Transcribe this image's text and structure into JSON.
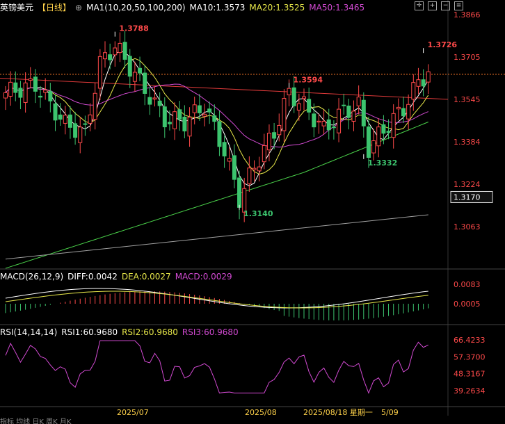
{
  "header": {
    "symbol": "英镑美元",
    "period": "【日线】",
    "ma_label": "MA1(10,20,50,100,200)",
    "ma10": "MA10:1.3573",
    "ma20": "MA20:1.3525",
    "ma50": "MA50:1.3465"
  },
  "macd_header": {
    "label": "MACD(26,12,9)",
    "diff": "DIFF:0.0042",
    "dea": "DEA:0.0027",
    "macd": "MACD:0.0029"
  },
  "rsi_header": {
    "label": "RSI(14,14,14)",
    "rsi1": "RSI1:60.9680",
    "rsi2": "RSI2:60.9680",
    "rsi3": "RSI3:60.9680"
  },
  "colors": {
    "up": "#ff4a4a",
    "down": "#3cc46e",
    "ma10": "#ffffff",
    "ma20": "#e8e84a",
    "ma50": "#d24ad2",
    "ma100": "#4ad24a",
    "ma200": "#a0a0a0",
    "trend": "#e03a3a",
    "rsi": "#d24ad2"
  },
  "chart_data": {
    "type": "candlestick",
    "y_axis_ticks": [
      "1.3866",
      "1.3705",
      "1.3545",
      "1.3384",
      "1.3224",
      "1.3063"
    ],
    "y_axis_values": [
      1.3866,
      1.3705,
      1.3545,
      1.3384,
      1.3224,
      1.3063
    ],
    "current_price": "1.3170",
    "x_labels": [
      "2025/07",
      "2025/08",
      "2025/08/18 星期一",
      "5/09"
    ],
    "annotations": [
      {
        "text": "1.3788",
        "value": 1.3788,
        "index": 22,
        "type": "high"
      },
      {
        "text": "1.3594",
        "value": 1.3594,
        "index": 57,
        "type": "high"
      },
      {
        "text": "1.3726",
        "value": 1.3726,
        "index": 84,
        "type": "high"
      },
      {
        "text": "1.3140",
        "value": 1.314,
        "index": 47,
        "type": "low"
      },
      {
        "text": "1.3332",
        "value": 1.3332,
        "index": 72,
        "type": "low"
      }
    ],
    "ohlc": [],
    "macd_ticks": [
      "0.0083",
      "0.0005"
    ],
    "rsi_ticks": [
      "66.4233",
      "57.3700",
      "48.3167",
      "39.2634"
    ],
    "rsi_ticks_values": [
      66.4233,
      57.37,
      48.3167,
      39.2634
    ]
  },
  "bottom_text": "指标  均线  日K  周K  月K"
}
